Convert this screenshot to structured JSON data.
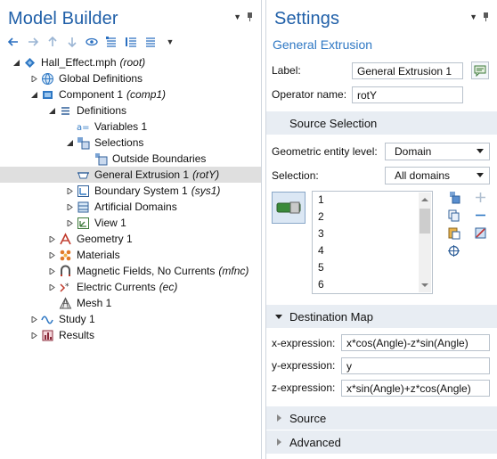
{
  "model_builder": {
    "title": "Model Builder",
    "tree": [
      {
        "label": "Hall_Effect.mph",
        "tag": "(root)",
        "depth": 0,
        "expanded": true,
        "icon": "model-file-icon"
      },
      {
        "label": "Global Definitions",
        "tag": "",
        "depth": 1,
        "expanded": false,
        "icon": "globe-icon"
      },
      {
        "label": "Component 1",
        "tag": "(comp1)",
        "depth": 1,
        "expanded": true,
        "icon": "component-icon"
      },
      {
        "label": "Definitions",
        "tag": "",
        "depth": 2,
        "expanded": true,
        "icon": "definitions-icon"
      },
      {
        "label": "Variables 1",
        "tag": "",
        "depth": 3,
        "expanded": null,
        "icon": "variables-icon"
      },
      {
        "label": "Selections",
        "tag": "",
        "depth": 3,
        "expanded": true,
        "icon": "selections-icon"
      },
      {
        "label": "Outside Boundaries",
        "tag": "",
        "depth": 4,
        "expanded": null,
        "icon": "selection-icon"
      },
      {
        "label": "General Extrusion 1",
        "tag": "(rotY)",
        "depth": 3,
        "expanded": null,
        "icon": "general-extrusion-icon",
        "selected": true
      },
      {
        "label": "Boundary System 1",
        "tag": "(sys1)",
        "depth": 3,
        "expanded": false,
        "icon": "boundary-system-icon"
      },
      {
        "label": "Artificial Domains",
        "tag": "",
        "depth": 3,
        "expanded": false,
        "icon": "artificial-domains-icon"
      },
      {
        "label": "View 1",
        "tag": "",
        "depth": 3,
        "expanded": false,
        "icon": "view-icon"
      },
      {
        "label": "Geometry 1",
        "tag": "",
        "depth": 2,
        "expanded": false,
        "icon": "geometry-icon"
      },
      {
        "label": "Materials",
        "tag": "",
        "depth": 2,
        "expanded": false,
        "icon": "materials-icon"
      },
      {
        "label": "Magnetic Fields, No Currents",
        "tag": "(mfnc)",
        "depth": 2,
        "expanded": false,
        "icon": "magnetic-fields-icon"
      },
      {
        "label": "Electric Currents",
        "tag": "(ec)",
        "depth": 2,
        "expanded": false,
        "icon": "electric-currents-icon"
      },
      {
        "label": "Mesh 1",
        "tag": "",
        "depth": 2,
        "expanded": null,
        "icon": "mesh-icon"
      },
      {
        "label": "Study 1",
        "tag": "",
        "depth": 1,
        "expanded": false,
        "icon": "study-icon"
      },
      {
        "label": "Results",
        "tag": "",
        "depth": 1,
        "expanded": false,
        "icon": "results-icon"
      }
    ]
  },
  "settings": {
    "title": "Settings",
    "subtitle": "General Extrusion",
    "label_caption": "Label:",
    "label_value": "General Extrusion 1",
    "operator_caption": "Operator name:",
    "operator_value": "rotY",
    "source_selection": {
      "header": "Source Selection",
      "entity_level_caption": "Geometric entity level:",
      "entity_level_value": "Domain",
      "selection_caption": "Selection:",
      "selection_value": "All domains",
      "items": [
        "1",
        "2",
        "3",
        "4",
        "5",
        "6"
      ]
    },
    "destination_map": {
      "header": "Destination Map",
      "x_caption": "x-expression:",
      "x_value": "x*cos(Angle)-z*sin(Angle)",
      "y_caption": "y-expression:",
      "y_value": "y",
      "z_caption": "z-expression:",
      "z_value": "x*sin(Angle)+z*cos(Angle)"
    },
    "source_header": "Source",
    "advanced_header": "Advanced"
  },
  "colors": {
    "title_blue": "#1f5fa8",
    "section_bg": "#e8edf3",
    "selected_row": "#dfdfdf"
  }
}
